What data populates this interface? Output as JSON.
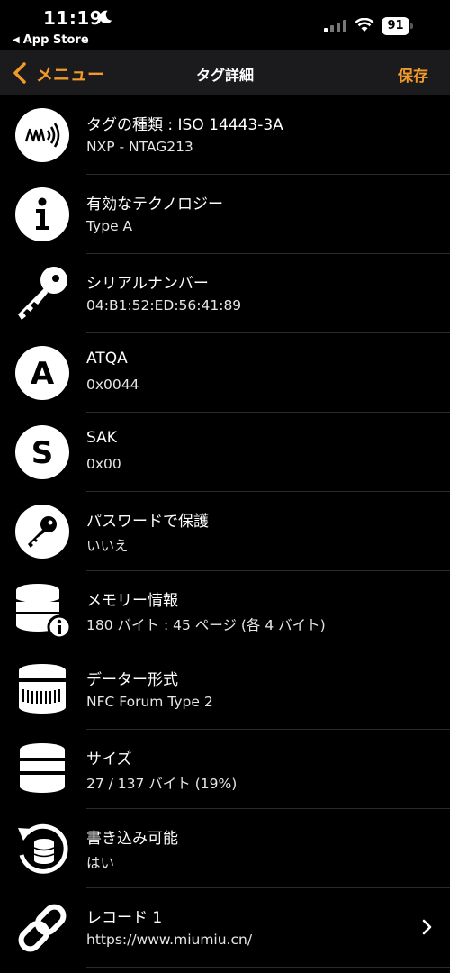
{
  "status_bar": {
    "time": "11:19",
    "back_app_label": "App Store",
    "battery_level": "91",
    "icons": [
      "moon-icon",
      "signal-icon",
      "wifi-icon",
      "battery-icon"
    ]
  },
  "nav": {
    "back_label": "メニュー",
    "title": "タグ詳細",
    "save_label": "保存",
    "accent_color": "#f19a2a"
  },
  "rows": [
    {
      "icon": "nfc-tag-icon",
      "title": "タグの種類 : ISO 14443-3A",
      "value": "NXP - NTAG213"
    },
    {
      "icon": "info-icon",
      "title": "有効なテクノロジー",
      "value": "Type A"
    },
    {
      "icon": "key-icon",
      "title": "シリアルナンバー",
      "value": "04:B1:52:ED:56:41:89"
    },
    {
      "icon": "letter-a-icon",
      "title": "ATQA",
      "value": "0x0044"
    },
    {
      "icon": "letter-s-icon",
      "title": "SAK",
      "value": "0x00"
    },
    {
      "icon": "password-key-icon",
      "title": "パスワードで保護",
      "value": "いいえ"
    },
    {
      "icon": "database-info-icon",
      "title": "メモリー情報",
      "value": "180 バイト : 45 ページ (各 4 バイト)"
    },
    {
      "icon": "database-format-icon",
      "title": "データー形式",
      "value": "NFC Forum Type 2"
    },
    {
      "icon": "database-icon",
      "title": "サイズ",
      "value": "27 / 137 バイト (19%)"
    },
    {
      "icon": "rewrite-database-icon",
      "title": "書き込み可能",
      "value": "はい"
    },
    {
      "icon": "link-icon",
      "title": "レコード 1",
      "value": "https://www.miumiu.cn/"
    }
  ]
}
